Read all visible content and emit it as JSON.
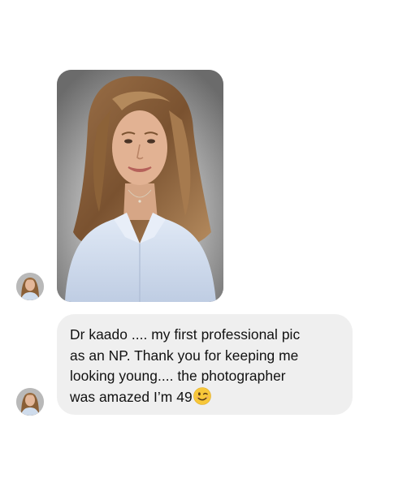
{
  "conversation": {
    "messages": [
      {
        "kind": "photo",
        "content": "professional-portrait-photo"
      },
      {
        "kind": "text",
        "lines": [
          "Dr kaado .... my first professional pic",
          "as an NP. Thank you for keeping me",
          "looking young.... the photographer",
          "was amazed I’m 49"
        ],
        "trailing_emoji": "winking-face-emoji"
      }
    ]
  },
  "colors": {
    "background": "#ffffff",
    "incoming_bubble": "#efefef",
    "message_text": "#111111"
  }
}
